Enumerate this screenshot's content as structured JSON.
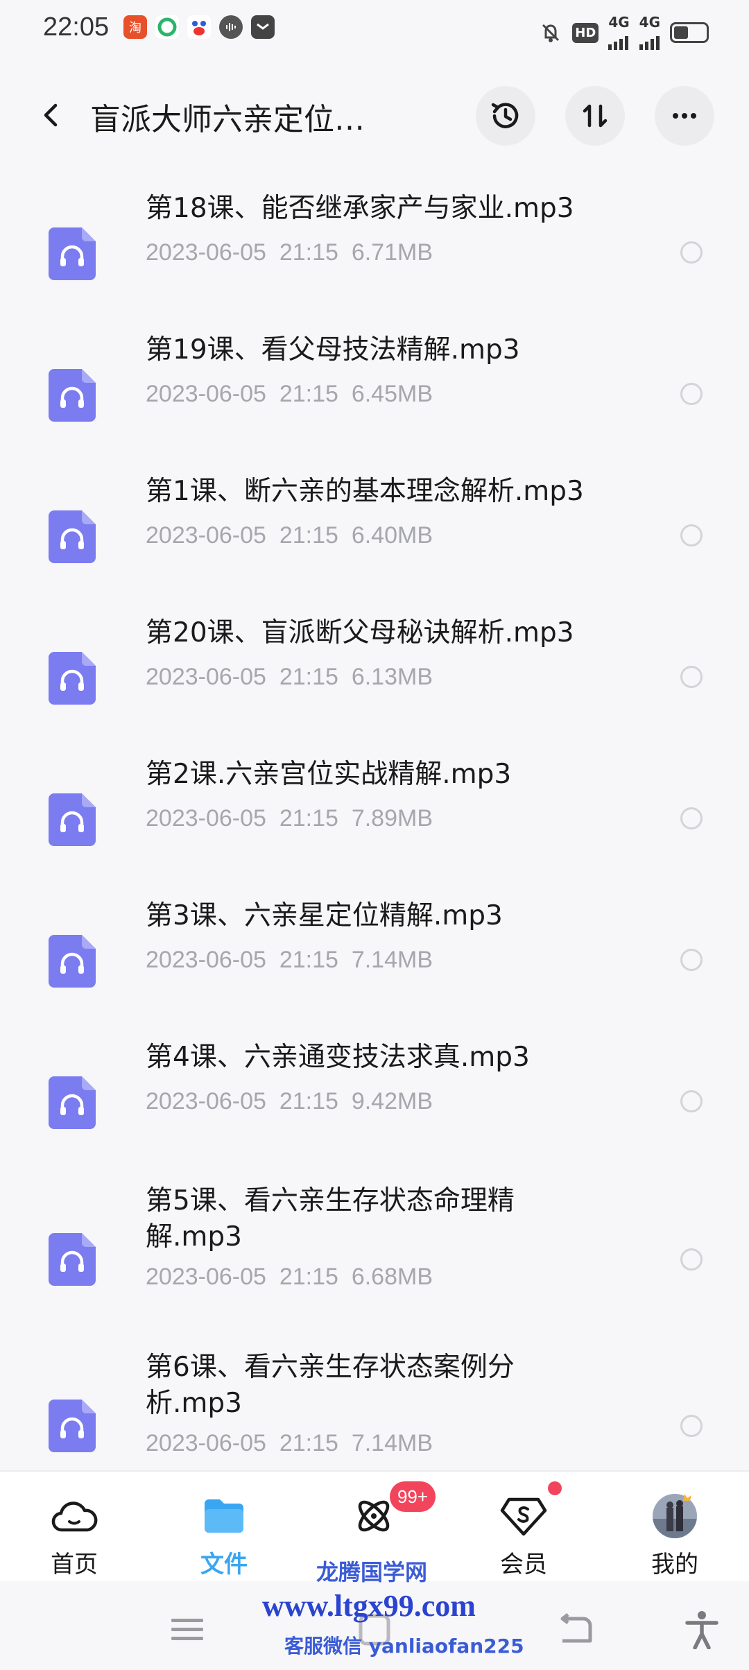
{
  "status_bar": {
    "time": "22:05",
    "hd": "HD",
    "net_1": "4G",
    "net_2": "4G"
  },
  "header": {
    "title": "盲派大师六亲定位…",
    "history_icon": "history-icon",
    "sort_icon": "sort-icon",
    "more_icon": "more-icon"
  },
  "files": [
    {
      "name": "第18课、能否继承家产与家业.mp3",
      "date": "2023-06-05",
      "time": "21:15",
      "size": "6.71MB"
    },
    {
      "name": "第19课、看父母技法精解.mp3",
      "date": "2023-06-05",
      "time": "21:15",
      "size": "6.45MB"
    },
    {
      "name": "第1课、断六亲的基本理念解析.mp3",
      "date": "2023-06-05",
      "time": "21:15",
      "size": "6.40MB"
    },
    {
      "name": "第20课、盲派断父母秘诀解析.mp3",
      "date": "2023-06-05",
      "time": "21:15",
      "size": "6.13MB"
    },
    {
      "name": "第2课.六亲宫位实战精解.mp3",
      "date": "2023-06-05",
      "time": "21:15",
      "size": "7.89MB"
    },
    {
      "name": "第3课、六亲星定位精解.mp3",
      "date": "2023-06-05",
      "time": "21:15",
      "size": "7.14MB"
    },
    {
      "name": "第4课、六亲通变技法求真.mp3",
      "date": "2023-06-05",
      "time": "21:15",
      "size": "9.42MB"
    },
    {
      "name": "第5课、看六亲生存状态命理精解.mp3",
      "date": "2023-06-05",
      "time": "21:15",
      "size": "6.68MB"
    },
    {
      "name": "第6课、看六亲生存状态案例分析.mp3",
      "date": "2023-06-05",
      "time": "21:15",
      "size": "7.14MB"
    }
  ],
  "bottom_nav": {
    "items": [
      {
        "label": "首页",
        "icon": "cloud-home-icon"
      },
      {
        "label": "文件",
        "icon": "folder-icon"
      },
      {
        "label": "",
        "icon": "atom-icon"
      },
      {
        "label": "会员",
        "icon": "vip-gem-icon"
      },
      {
        "label": "我的",
        "icon": "avatar"
      }
    ],
    "active_index": 1,
    "badge": "99+"
  },
  "watermark": {
    "line1": "龙腾国学网",
    "line2": "www.ltgx99.com",
    "line3": "客服微信 yanliaofan225"
  },
  "colors": {
    "accent": "#3aa6f2",
    "file_icon": "#7b7cf0",
    "badge": "#f2455c",
    "meta_text": "#a6a6ad"
  }
}
